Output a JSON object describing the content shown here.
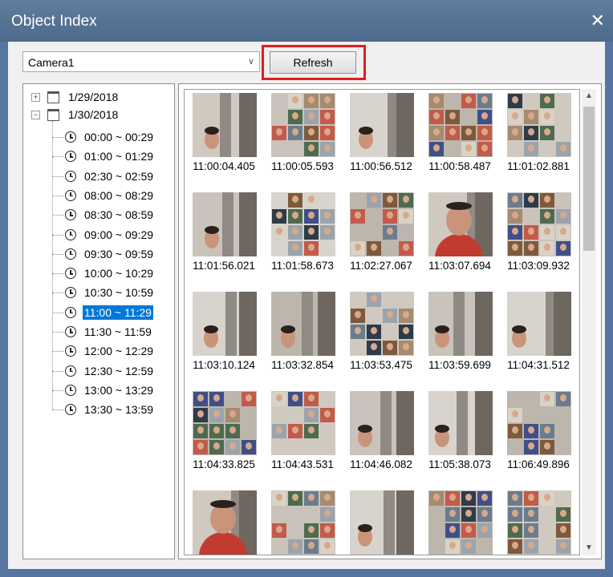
{
  "window": {
    "title": "Object Index",
    "close_glyph": "✕"
  },
  "toolbar": {
    "camera_value": "Camera1",
    "dropdown_icon": "chevron-down-icon",
    "refresh_label": "Refresh",
    "highlight_color": "#e01d1d"
  },
  "tree": {
    "dates": [
      {
        "label": "1/29/2018",
        "expander": "+",
        "expanded": false
      },
      {
        "label": "1/30/2018",
        "expander": "−",
        "expanded": true
      }
    ],
    "times": [
      "00:00 ~ 00:29",
      "01:00 ~ 01:29",
      "02:30 ~ 02:59",
      "08:00 ~ 08:29",
      "08:30 ~ 08:59",
      "09:00 ~ 09:29",
      "09:30 ~ 09:59",
      "10:00 ~ 10:29",
      "10:30 ~ 10:59",
      "11:00 ~ 11:29",
      "11:30 ~ 11:59",
      "12:00 ~ 12:29",
      "12:30 ~ 12:59",
      "13:00 ~ 13:29",
      "13:30 ~ 13:59"
    ],
    "selected_time": "11:00 ~ 11:29",
    "selection_color": "#0078d7"
  },
  "thumbnails": [
    [
      "11:00:04.405",
      "11:00:05.593",
      "11:00:56.512",
      "11:00:58.487",
      "11:01:02.881"
    ],
    [
      "11:01:56.021",
      "11:01:58.673",
      "11:02:27.067",
      "11:03:07.694",
      "11:03:09.932"
    ],
    [
      "11:03:10.124",
      "11:03:32.854",
      "11:03:53.475",
      "11:03:59.699",
      "11:04:31.512"
    ],
    [
      "11:04:33.825",
      "11:04:43.531",
      "11:04:46.082",
      "11:05:38.073",
      "11:06:49.896"
    ],
    [
      "",
      "",
      "",
      "",
      ""
    ]
  ],
  "thumbnail_kinds": [
    [
      "doorway",
      "mosaic",
      "doorway",
      "mosaic",
      "mosaic"
    ],
    [
      "doorway",
      "mosaic",
      "mosaic",
      "portrait",
      "mosaic"
    ],
    [
      "doorway",
      "doorway",
      "mosaic",
      "doorway",
      "doorway"
    ],
    [
      "mosaic",
      "mosaic",
      "doorway",
      "doorway",
      "mosaic"
    ],
    [
      "portrait",
      "mosaic",
      "doorway",
      "mosaic",
      "mosaic"
    ]
  ]
}
